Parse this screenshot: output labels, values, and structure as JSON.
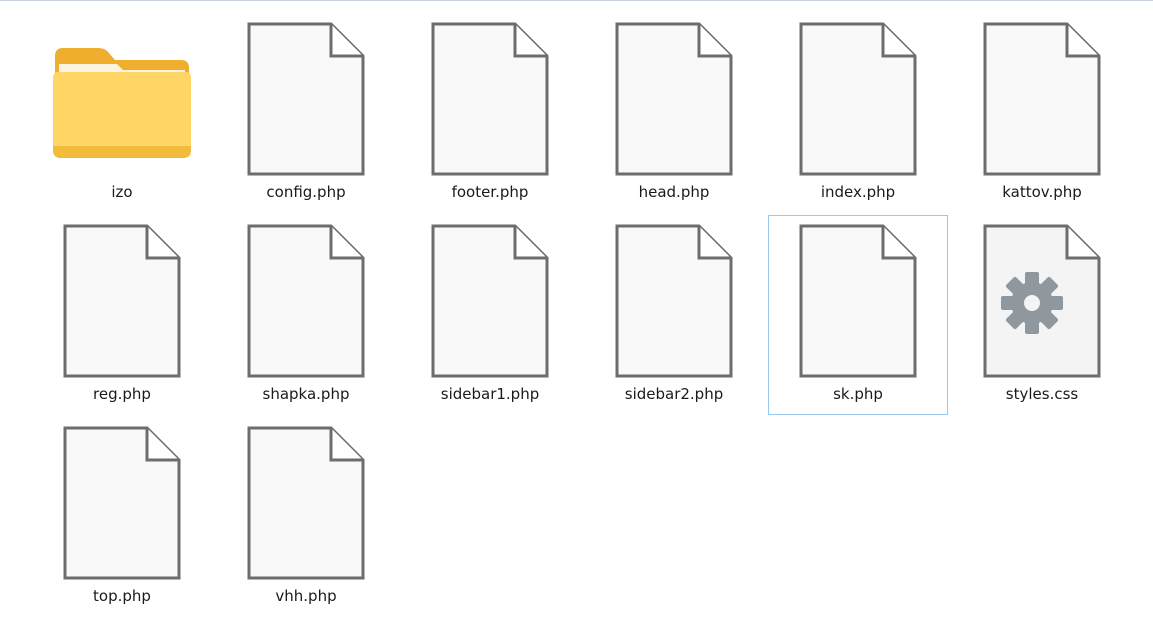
{
  "view": "File Explorer - large icons",
  "items": [
    {
      "name": "izo",
      "type": "folder",
      "icon": "folder-icon",
      "selected": false
    },
    {
      "name": "config.php",
      "type": "file",
      "icon": "file-icon",
      "selected": false
    },
    {
      "name": "footer.php",
      "type": "file",
      "icon": "file-icon",
      "selected": false
    },
    {
      "name": "head.php",
      "type": "file",
      "icon": "file-icon",
      "selected": false
    },
    {
      "name": "index.php",
      "type": "file",
      "icon": "file-icon",
      "selected": false
    },
    {
      "name": "kattov.php",
      "type": "file",
      "icon": "file-icon",
      "selected": false
    },
    {
      "name": "reg.php",
      "type": "file",
      "icon": "file-icon",
      "selected": false
    },
    {
      "name": "shapka.php",
      "type": "file",
      "icon": "file-icon",
      "selected": false
    },
    {
      "name": "sidebar1.php",
      "type": "file",
      "icon": "file-icon",
      "selected": false
    },
    {
      "name": "sidebar2.php",
      "type": "file",
      "icon": "file-icon",
      "selected": false
    },
    {
      "name": "sk.php",
      "type": "file",
      "icon": "file-icon",
      "selected": true
    },
    {
      "name": "styles.css",
      "type": "settings-file",
      "icon": "gear-file-icon",
      "selected": false
    },
    {
      "name": "top.php",
      "type": "file",
      "icon": "file-icon",
      "selected": false
    },
    {
      "name": "vhh.php",
      "type": "file",
      "icon": "file-icon",
      "selected": false
    }
  ],
  "colors": {
    "selection_border": "#99c9ef",
    "folder_back": "#f5b83a",
    "folder_front": "#ffd869",
    "file_outline": "#6d6d6d",
    "gear": "#8f979f"
  }
}
